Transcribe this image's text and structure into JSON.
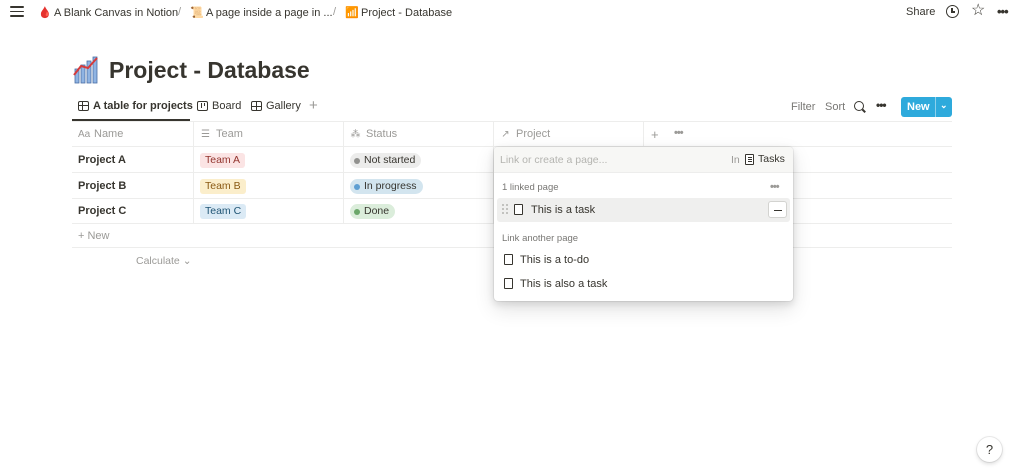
{
  "topbar": {
    "breadcrumbs": [
      {
        "icon": "🩸",
        "label": "A Blank Canvas in Notion"
      },
      {
        "icon": "📜",
        "label": "A page inside a page in ..."
      },
      {
        "icon": "📶",
        "label": "Project - Database"
      }
    ],
    "separator": "/",
    "share_label": "Share"
  },
  "page": {
    "icon": "chart-icon",
    "title": "Project - Database"
  },
  "views": {
    "tabs": [
      {
        "label": "A table for projects",
        "active": true
      },
      {
        "label": "Board",
        "active": false
      },
      {
        "label": "Gallery",
        "active": false
      }
    ],
    "add_symbol": "+",
    "filter_label": "Filter",
    "sort_label": "Sort",
    "more_symbol": "•••",
    "new_label": "New",
    "new_caret": "⌄"
  },
  "table": {
    "columns": [
      {
        "icon": "Aa",
        "label": "Name"
      },
      {
        "icon": "☰",
        "label": "Team"
      },
      {
        "icon": "⁂",
        "label": "Status"
      },
      {
        "icon": "↗",
        "label": "Project"
      }
    ],
    "add_column": "+",
    "more_column": "•••",
    "rows": [
      {
        "name": "Project A",
        "team": "Team A",
        "status": "Not started"
      },
      {
        "name": "Project B",
        "team": "Team B",
        "status": "In progress"
      },
      {
        "name": "Project C",
        "team": "Team C",
        "status": "Done"
      }
    ],
    "new_row_label": "+ New",
    "calculate_label": "Calculate ⌄"
  },
  "colors": {
    "team_a_bg": "#fbe4e4",
    "team_a_fg": "#93342e",
    "team_b_bg": "#fbeecb",
    "team_b_fg": "#8a5a14",
    "team_c_bg": "#dbeaf5",
    "team_c_fg": "#1f5474",
    "not_started_bg": "#ececeb",
    "not_started_dot": "#91918e",
    "in_progress_bg": "#d3e5ef",
    "in_progress_dot": "#5e9fd2",
    "done_bg": "#dbeddb",
    "done_dot": "#6ba76a",
    "accent": "#2eaadc"
  },
  "relation_popup": {
    "search_placeholder": "Link or create a page...",
    "in_label": "In",
    "database_name": "Tasks",
    "linked_section": "1 linked page",
    "linked_more": "•••",
    "linked_pages": [
      "This is a task"
    ],
    "other_section": "Link another page",
    "other_pages": [
      "This is a to-do",
      "This is also a task"
    ]
  },
  "help_label": "?"
}
